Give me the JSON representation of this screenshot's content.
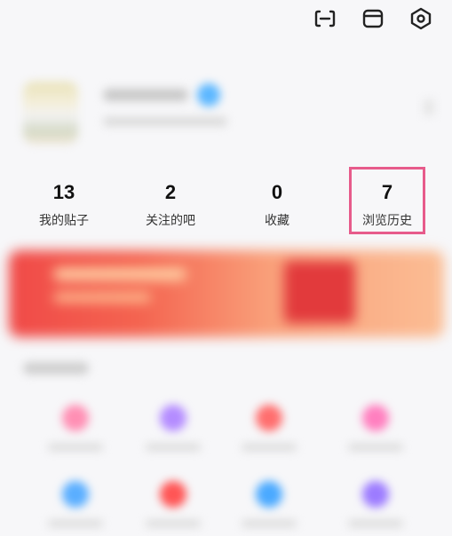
{
  "header": {
    "icons": [
      {
        "name": "scan-icon"
      },
      {
        "name": "box-icon"
      },
      {
        "name": "settings-icon"
      }
    ]
  },
  "profile": {
    "avatar": "avatar",
    "blurred": true
  },
  "stats": [
    {
      "count": "13",
      "label": "我的贴子"
    },
    {
      "count": "2",
      "label": "关注的吧"
    },
    {
      "count": "0",
      "label": "收藏"
    },
    {
      "count": "7",
      "label": "浏览历史"
    }
  ],
  "banner": {
    "blurred": true,
    "colors": {
      "start": "#f04a48",
      "end": "#fbbd94"
    }
  },
  "services": {
    "row1": [
      {
        "icon": "pink-circle-icon",
        "color": "#ff8fb4"
      },
      {
        "icon": "purple-circle-icon",
        "color": "#b48cff"
      },
      {
        "icon": "red-circle-icon",
        "color": "#ff6e6e"
      },
      {
        "icon": "pink-circle-icon",
        "color": "#ff7fbf"
      }
    ],
    "row2": [
      {
        "icon": "blue-circle-icon",
        "color": "#5aaeff"
      },
      {
        "icon": "red-pen-icon",
        "color": "#ff5555"
      },
      {
        "icon": "blue-circle-icon",
        "color": "#4aa9ff"
      },
      {
        "icon": "purple-circle-icon",
        "color": "#9c7bff"
      }
    ]
  },
  "accent_highlight": "#e75b8b"
}
